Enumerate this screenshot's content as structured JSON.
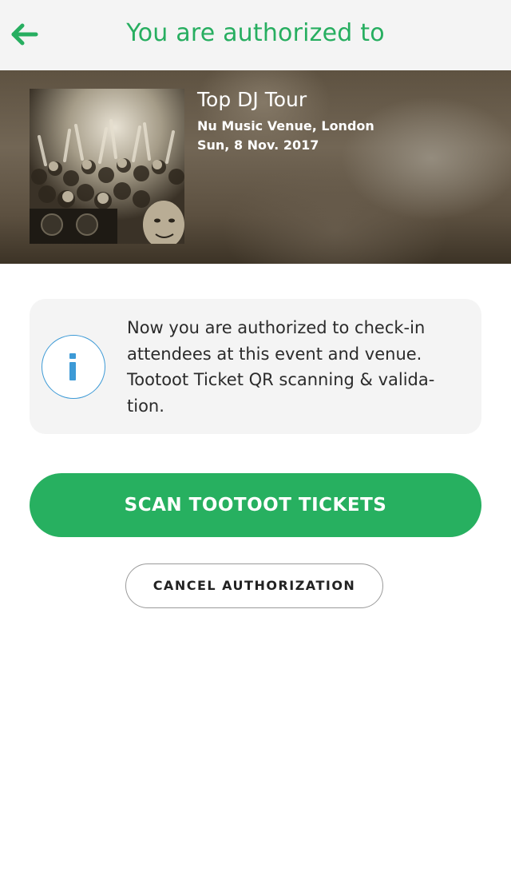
{
  "header": {
    "title": "You are authorized to",
    "back_icon": "arrow-left-icon",
    "accent_color": "#27ae60"
  },
  "event": {
    "name": "Top DJ Tour",
    "venue": "Nu Music Venue, London",
    "date": "Sun, 8 Nov. 2017",
    "image": "crowd-photo"
  },
  "info": {
    "icon": "info-icon",
    "line1": "Now you are authorized to check-in",
    "line2": "attendees at this event and venue.",
    "line3": "Tootoot Ticket QR scanning & valida-",
    "line4": "tion."
  },
  "actions": {
    "scan_label": "SCAN TOOTOOT TICKETS",
    "cancel_label": "CANCEL AUTHORIZATION",
    "scan_color": "#27b060"
  }
}
